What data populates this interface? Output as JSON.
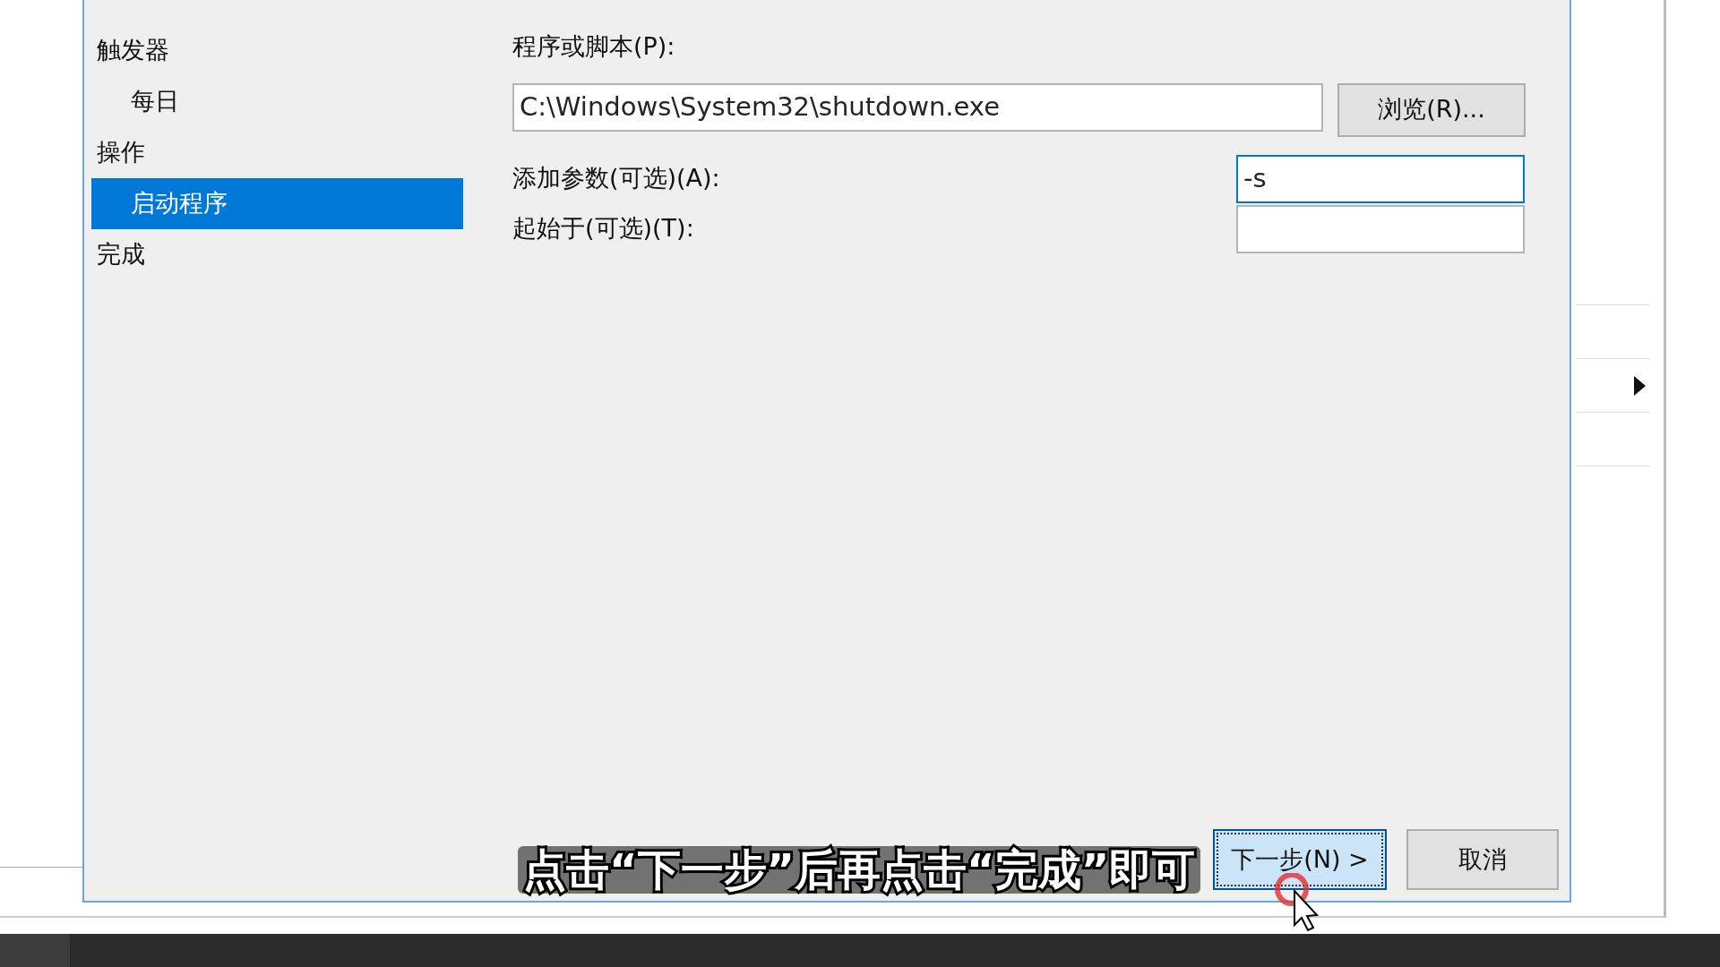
{
  "sidebar": {
    "items": [
      {
        "label": "触发器",
        "selected": false,
        "children": [
          {
            "label": "每日",
            "selected": false
          }
        ]
      },
      {
        "label": "操作",
        "selected": false,
        "children": [
          {
            "label": "启动程序",
            "selected": true
          }
        ]
      },
      {
        "label": "完成",
        "selected": false
      }
    ]
  },
  "program": {
    "label": "程序或脚本(P):",
    "value": "C:\\Windows\\System32\\shutdown.exe",
    "browse": "浏览(R)..."
  },
  "fields": [
    {
      "label": "添加参数(可选)(A):",
      "value": "-s",
      "focused": true
    },
    {
      "label": "起始于(可选)(T):",
      "focused": false
    }
  ],
  "buttons": [
    {
      "kind": "next",
      "label": "下一步(N) >",
      "focused": true
    },
    {
      "kind": "cancel",
      "label": "取消",
      "focused": false
    }
  ],
  "caption": "点击“下一步”后再点击“完成”即可"
}
